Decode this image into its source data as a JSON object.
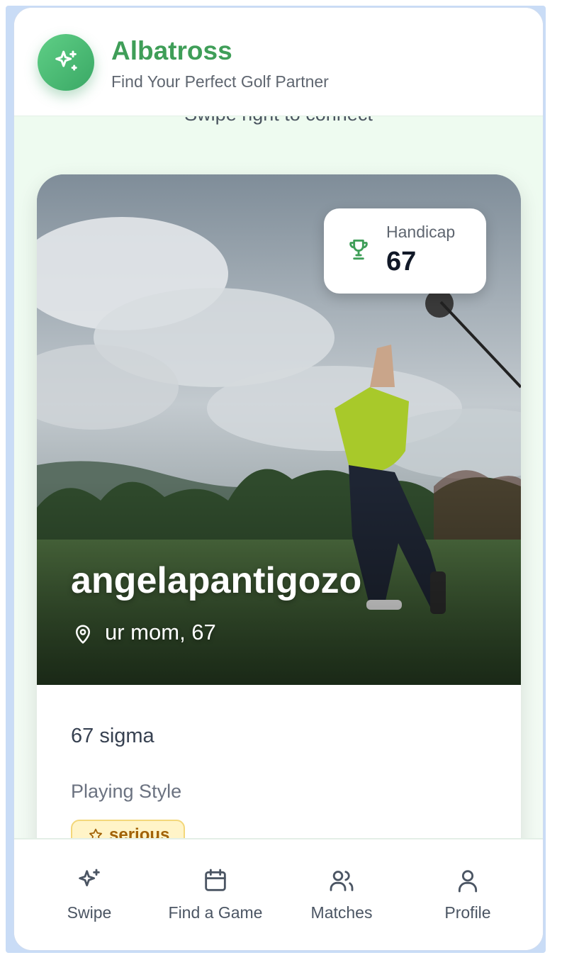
{
  "app": {
    "title": "Albatross",
    "subtitle": "Find Your Perfect Golf Partner",
    "logo_icon": "sparkles-icon"
  },
  "main": {
    "swipe_hint": "Swipe right to connect"
  },
  "profile_card": {
    "handicap_label": "Handicap",
    "handicap_value": "67",
    "username": "angelapantigozo",
    "location": "ur mom, 67",
    "bio": "67 sigma",
    "playing_style_title": "Playing Style",
    "playing_style_chip": "serious"
  },
  "bottom_nav": {
    "items": [
      {
        "label": "Swipe",
        "icon": "sparkles-icon"
      },
      {
        "label": "Find a Game",
        "icon": "calendar-icon"
      },
      {
        "label": "Matches",
        "icon": "users-icon"
      },
      {
        "label": "Profile",
        "icon": "user-icon"
      }
    ]
  },
  "colors": {
    "brand_green": "#3f9e58",
    "chip_bg": "#fff4c8",
    "chip_text": "#a16207"
  }
}
